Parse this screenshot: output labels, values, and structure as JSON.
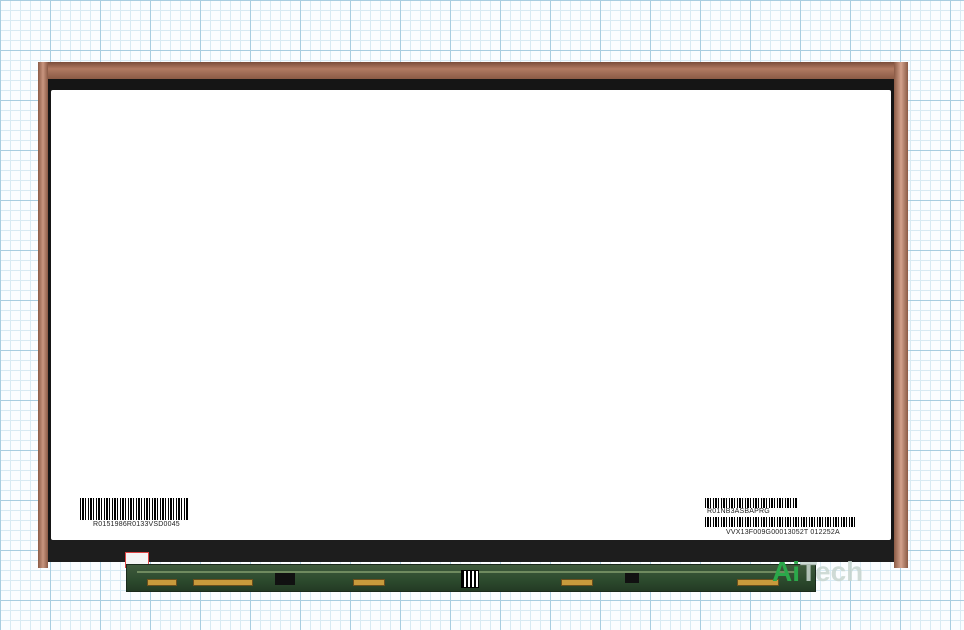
{
  "product": {
    "label_left": "R0151986R0133VSD0045",
    "label_right_top": "R01NB3ASBAPRG",
    "label_right_bottom": "VVX13F009G00013052T 012252A"
  },
  "watermark": {
    "part_a": "Ai",
    "part_b": "Tech"
  },
  "colors": {
    "grid_line": "#a9cde0",
    "copper_foil": "#b07a62",
    "pcb": "#2c4a2d",
    "watermark_accent": "#2ba84a"
  }
}
